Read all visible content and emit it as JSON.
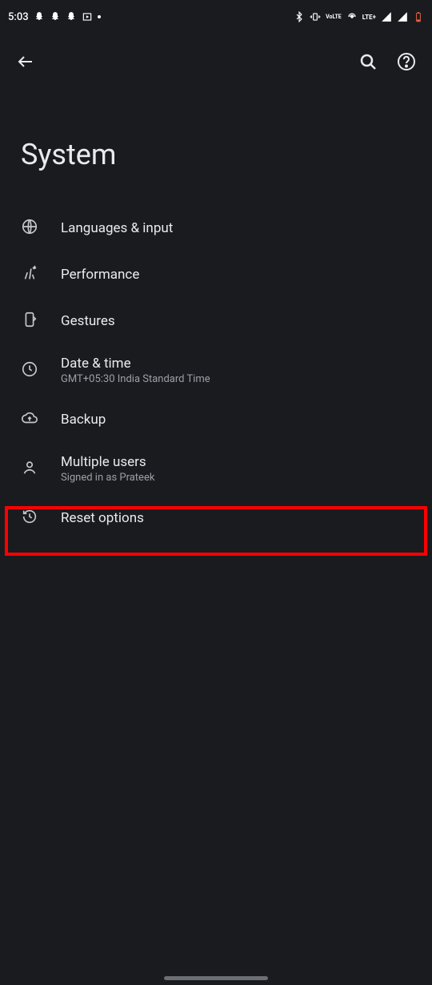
{
  "status": {
    "time": "5:03",
    "left_icons": [
      "snapchat-icon",
      "snapchat-icon",
      "snapchat-icon",
      "picture-in-picture-icon"
    ],
    "right_icons": [
      "bluetooth-icon",
      "vibrate-icon",
      "volte-icon",
      "hotspot-icon",
      "lte-plus-icon",
      "signal-icon",
      "signal-roaming-icon",
      "battery-low-icon"
    ],
    "lte_label": "LTE+",
    "volte_label": "VoLTE"
  },
  "page": {
    "title": "System"
  },
  "items": [
    {
      "icon": "globe-icon",
      "label": "Languages & input",
      "sub": ""
    },
    {
      "icon": "performance-icon",
      "label": "Performance",
      "sub": ""
    },
    {
      "icon": "gestures-icon",
      "label": "Gestures",
      "sub": ""
    },
    {
      "icon": "clock-icon",
      "label": "Date & time",
      "sub": "GMT+05:30 India Standard Time"
    },
    {
      "icon": "cloud-upload-icon",
      "label": "Backup",
      "sub": ""
    },
    {
      "icon": "person-icon",
      "label": "Multiple users",
      "sub": "Signed in as Prateek"
    },
    {
      "icon": "restore-icon",
      "label": "Reset options",
      "sub": ""
    }
  ],
  "highlight": {
    "item_index": 6
  }
}
